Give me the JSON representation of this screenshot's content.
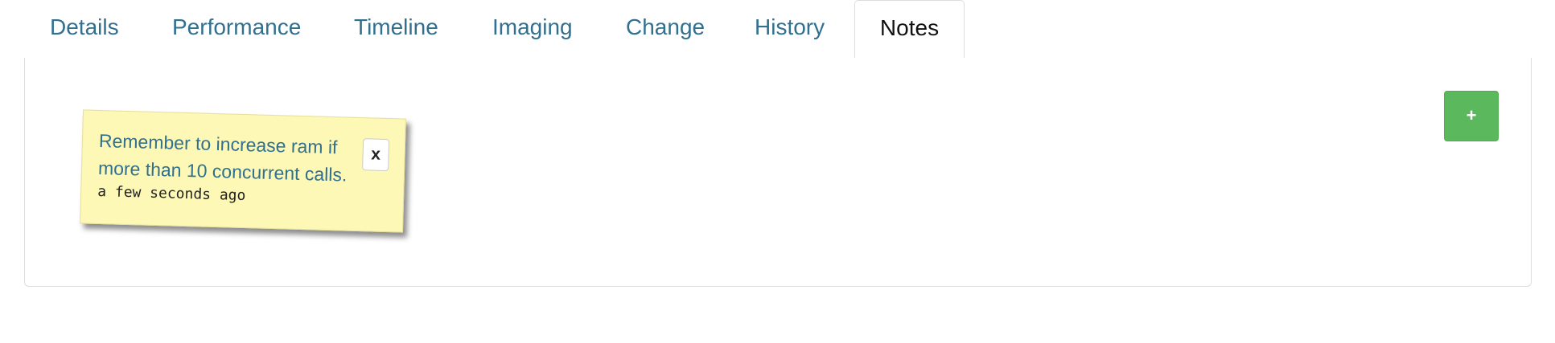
{
  "tabs": {
    "details": "Details",
    "performance": "Performance",
    "timeline": "Timeline",
    "imaging": "Imaging",
    "change": "Change",
    "history": "History",
    "notes": "Notes"
  },
  "notes_panel": {
    "add_button_label": "+",
    "add_button_color": "#5cb85c",
    "note": {
      "text": "Remember to increase ram if more than 10 concurrent calls.",
      "timestamp": "a few seconds ago",
      "close_label": "x",
      "background_color": "#fdf8b5"
    }
  },
  "colors": {
    "link": "#31708f",
    "active_tab_text": "#111111",
    "border": "#dddddd"
  }
}
